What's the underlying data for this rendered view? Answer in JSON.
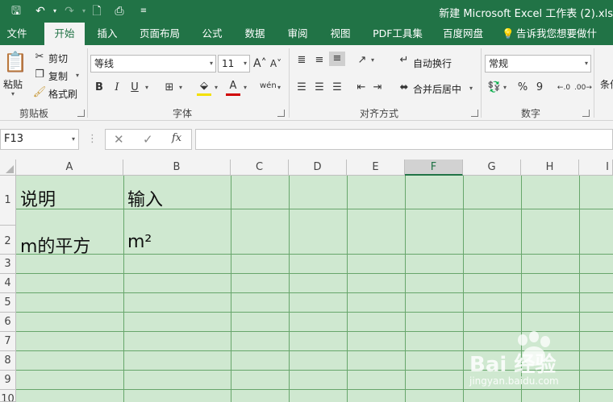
{
  "titlebar": {
    "title": "新建 Microsoft Excel 工作表 (2).xls"
  },
  "tabs": [
    {
      "label": "文件"
    },
    {
      "label": "开始"
    },
    {
      "label": "插入"
    },
    {
      "label": "页面布局"
    },
    {
      "label": "公式"
    },
    {
      "label": "数据"
    },
    {
      "label": "审阅"
    },
    {
      "label": "视图"
    },
    {
      "label": "PDF工具集"
    },
    {
      "label": "百度网盘"
    },
    {
      "label": "告诉我您想要做什么..."
    }
  ],
  "ribbon": {
    "clipboard": {
      "paste": "粘贴",
      "cut": "剪切",
      "copy": "复制",
      "format_painter": "格式刷",
      "label": "剪贴板"
    },
    "font": {
      "name": "等线",
      "size": "11",
      "bold": "B",
      "italic": "I",
      "underline": "U",
      "label": "字体"
    },
    "alignment": {
      "wrap": "自动换行",
      "merge": "合并后居中",
      "label": "对齐方式"
    },
    "number": {
      "format": "常规",
      "percent": "%",
      "comma": "9",
      "label": "数字"
    },
    "styles": {
      "conditional": "条件"
    }
  },
  "formula_bar": {
    "name_box": "F13",
    "formula": "",
    "fx": "fx"
  },
  "columns": [
    "A",
    "B",
    "C",
    "D",
    "E",
    "F",
    "G",
    "H",
    "I"
  ],
  "rows": [
    "1",
    "2",
    "3",
    "4",
    "5",
    "6",
    "7",
    "8",
    "9",
    "10"
  ],
  "cells": {
    "A1": "说明",
    "B1": "输入",
    "A2": "m的平方",
    "B2": "m²"
  },
  "watermark": {
    "brand": "Bai  经验",
    "url": "jingyan.baidu.com"
  },
  "colors": {
    "accent": "#217346",
    "grid_fill": "#cfe8d0",
    "grid_line": "#67a66b"
  }
}
